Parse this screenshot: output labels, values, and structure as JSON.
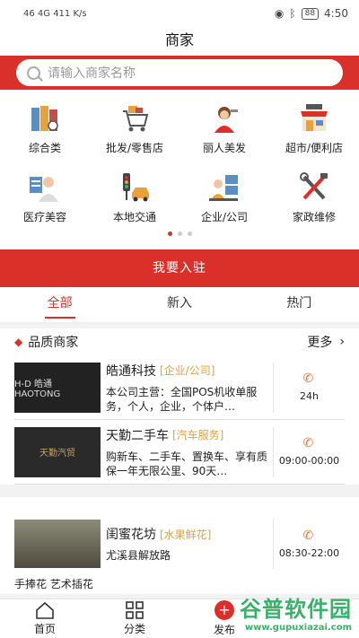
{
  "status": {
    "left": "46 4G 411 K/s",
    "battery": "88",
    "time": "4:50"
  },
  "title": "商家",
  "search": {
    "placeholder": "请输入商家名称"
  },
  "categories": [
    {
      "label": "综合类",
      "icon": "folders-icon"
    },
    {
      "label": "批发/零售店",
      "icon": "cart-icon"
    },
    {
      "label": "丽人美发",
      "icon": "hairdresser-icon"
    },
    {
      "label": "超市/便利店",
      "icon": "shop-icon"
    },
    {
      "label": "医疗美容",
      "icon": "doctor-icon"
    },
    {
      "label": "本地交通",
      "icon": "traffic-icon"
    },
    {
      "label": "企业/公司",
      "icon": "office-icon"
    },
    {
      "label": "家政维修",
      "icon": "tools-icon"
    }
  ],
  "join_label": "我要入驻",
  "tabs": [
    "全部",
    "新入",
    "热门"
  ],
  "quality": {
    "title": "品质商家",
    "more": "更多"
  },
  "merchants": [
    {
      "name": "皓通科技",
      "tag": "[企业/公司]",
      "desc": "本公司主营：全国POS机收单服务，个人，企业，个体户…",
      "hours": "24h",
      "thumb": "H-D 皓通 HAOTONG"
    },
    {
      "name": "天勤二手车",
      "tag": "[汽车服务]",
      "desc": "购新车、二手车、置换车、享有质保一年无限公里、90天…",
      "hours": "09:00-00:00",
      "thumb": "天勤汽贸"
    }
  ],
  "shop": {
    "name": "闺蜜花坊",
    "tag": "[水果鲜花]",
    "address": "尤溪县解放路",
    "hours": "08:30-22:00",
    "footer": "手捧花 艺术插花"
  },
  "nav": [
    {
      "label": "首页"
    },
    {
      "label": "分类"
    },
    {
      "label": "发布"
    }
  ],
  "watermark": {
    "title": "谷普软件园",
    "url": "www.gupuxiazai.com"
  }
}
